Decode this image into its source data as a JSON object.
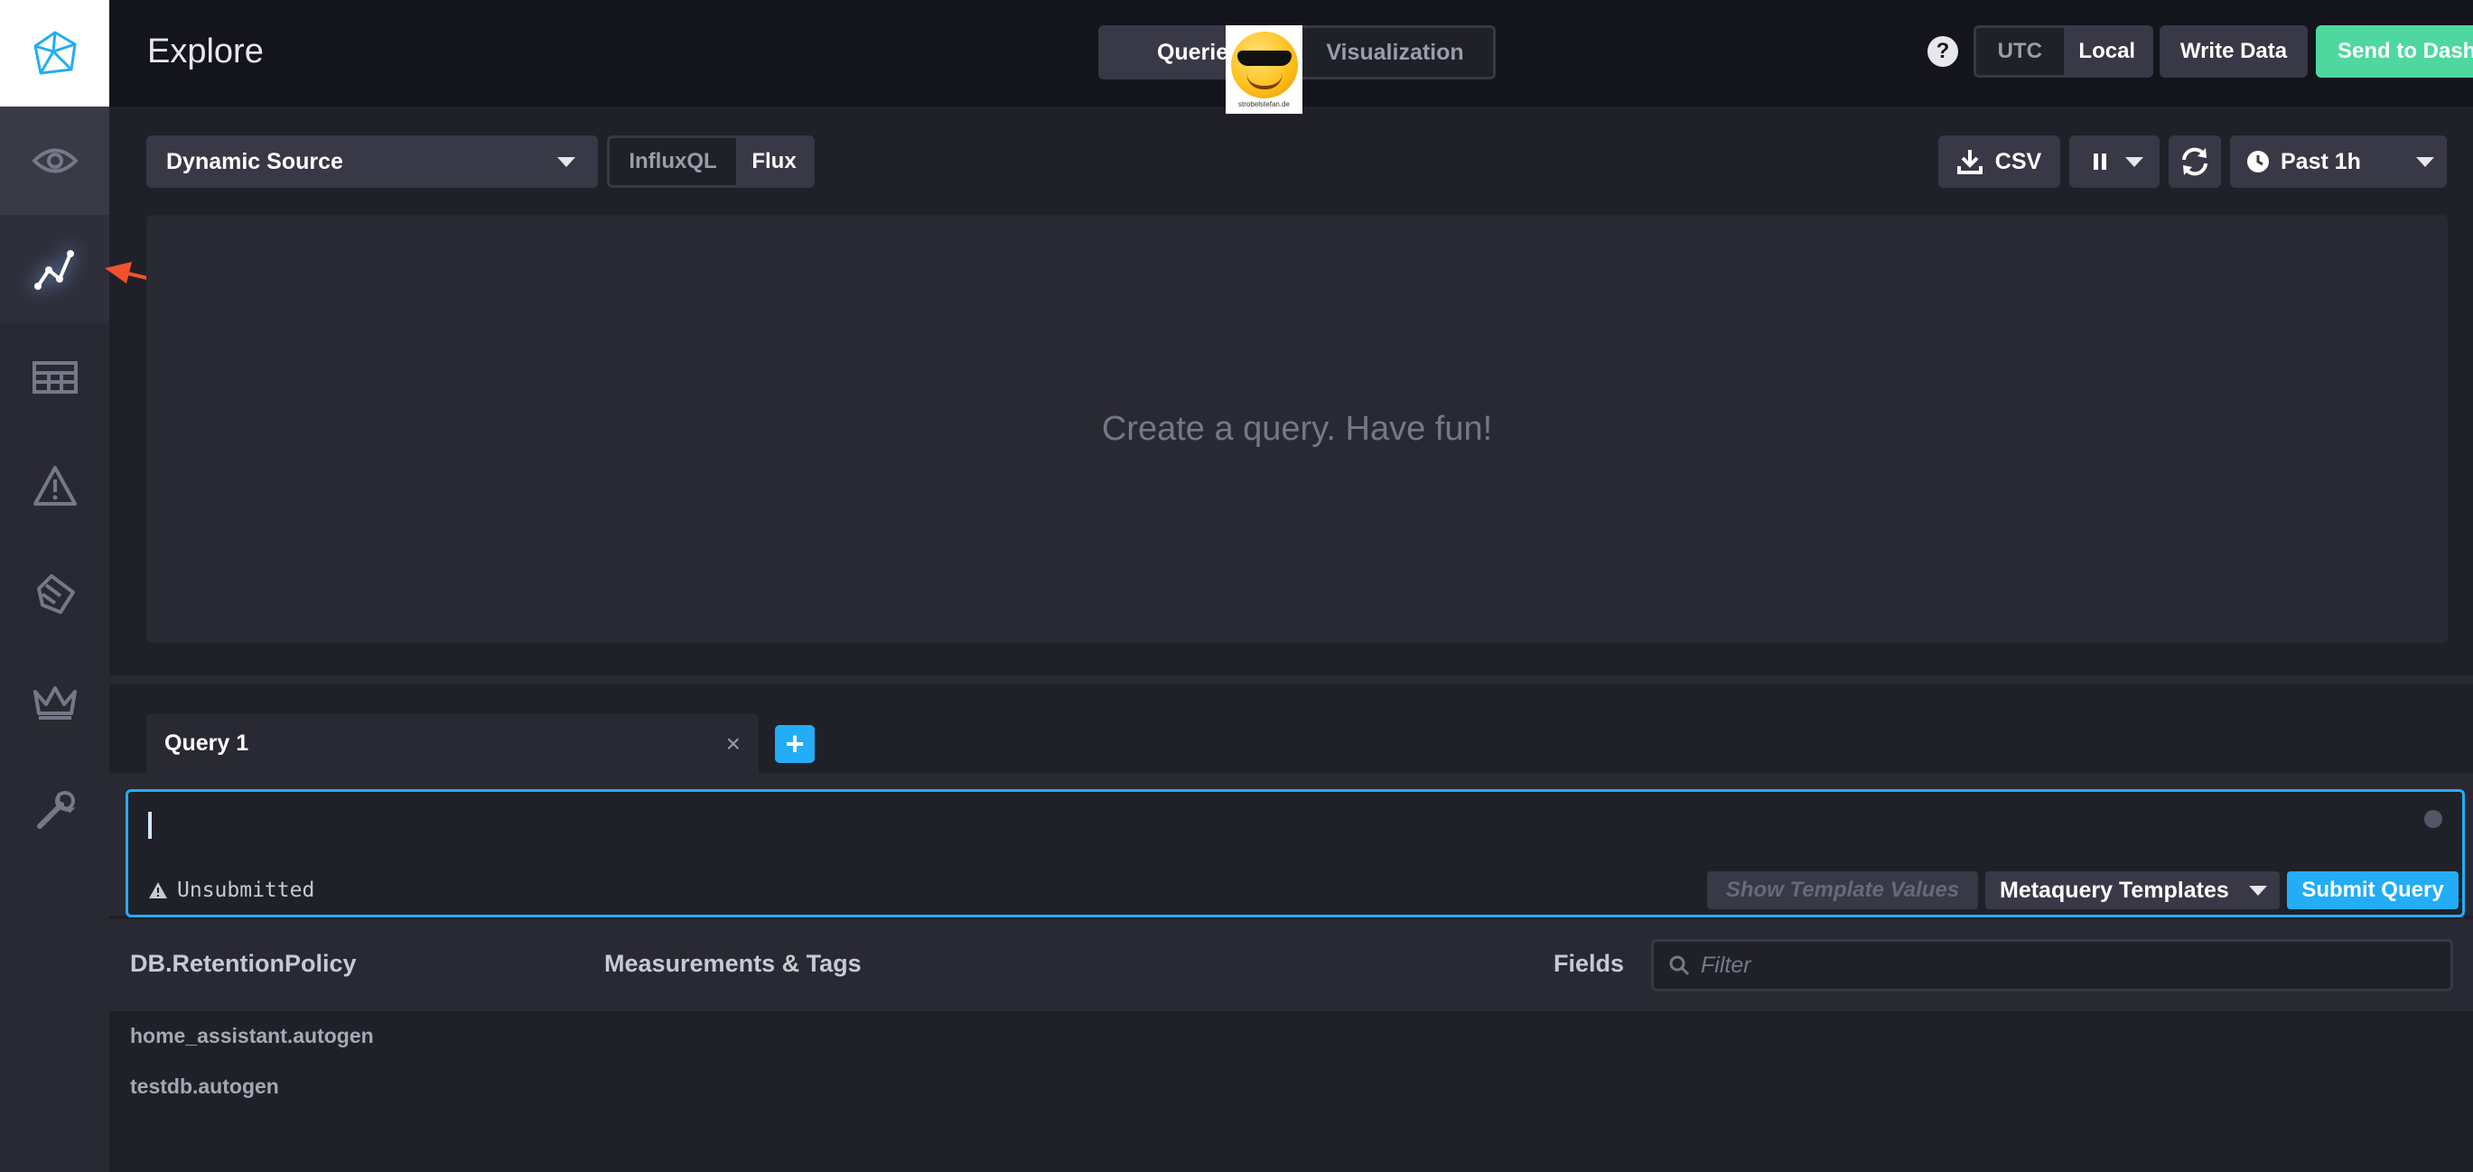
{
  "header": {
    "title": "Explore",
    "mode_tabs": [
      {
        "label": "Queries",
        "active": true
      },
      {
        "label": "Visualization",
        "active": false
      }
    ],
    "help_label": "?",
    "timezones": [
      {
        "label": "UTC",
        "active": false
      },
      {
        "label": "Local",
        "active": true
      }
    ],
    "write_data_label": "Write Data",
    "send_to_dashboard_label": "Send to Dashboard",
    "emoji_caption": "strobelstefan.de"
  },
  "sidebar": {
    "items": [
      {
        "name": "eye-icon"
      },
      {
        "name": "explore-graph-icon",
        "active": true
      },
      {
        "name": "dashboards-grid-icon"
      },
      {
        "name": "alert-triangle-icon"
      },
      {
        "name": "log-viewer-icon"
      },
      {
        "name": "crown-icon"
      },
      {
        "name": "wrench-icon"
      }
    ]
  },
  "toolbar": {
    "source": "Dynamic Source",
    "languages": [
      {
        "label": "InfluxQL",
        "active": true
      },
      {
        "label": "Flux",
        "active": false
      }
    ],
    "csv_label": "CSV",
    "time_range": "Past 1h"
  },
  "graph": {
    "empty_message": "Create a query. Have fun!"
  },
  "query": {
    "tab_label": "Query 1",
    "close_label": "×",
    "add_label": "+",
    "editor_value": "",
    "status": "Unsubmitted",
    "show_template_values_label": "Show Template Values",
    "metaquery_templates_label": "Metaquery Templates",
    "submit_label": "Submit Query"
  },
  "schema": {
    "db_column_title": "DB.RetentionPolicy",
    "measurements_column_title": "Measurements & Tags",
    "fields_column_title": "Fields",
    "filter_placeholder": "Filter",
    "databases": [
      "home_assistant.autogen",
      "testdb.autogen"
    ]
  },
  "colors": {
    "accent_blue": "#22adf6",
    "success_green": "#4ed8a0",
    "annotation_arrow": "#f0522d"
  }
}
